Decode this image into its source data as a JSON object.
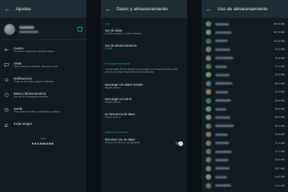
{
  "panel1": {
    "title": "Ajustes",
    "back_icon": "arrow-left-icon",
    "accent": "#00a884",
    "menu": [
      {
        "label": "Cuenta",
        "sub": "Privacidad, seguridad, cambiar número",
        "icon": "key-icon"
      },
      {
        "label": "Chats",
        "sub": "Tema, fondos de pantalla, historial de chat",
        "icon": "chat-icon"
      },
      {
        "label": "Notificaciones",
        "sub": "Tonos de mensajes, grupos y llamadas",
        "icon": "bell-icon"
      },
      {
        "label": "Datos y almacenamiento",
        "sub": "Uso de red, descarga automática",
        "icon": "data-circle-icon"
      },
      {
        "label": "Ayuda",
        "sub": "Preguntas frecuentes, contáctanos, políticas",
        "icon": "help-icon"
      },
      {
        "label": "Invitar amigos",
        "sub": "",
        "icon": "people-icon"
      }
    ],
    "from": "from",
    "brand": "FACEBOOK"
  },
  "panel2": {
    "title": "Datos y almacenamiento",
    "uso_header": "Uso",
    "datos_label": "Uso de datos",
    "datos_sub": "6.6 GB enviados • 2.6 GB recibidos",
    "alm_label": "Uso de almacenamiento",
    "alm_sub": "1.5 GB",
    "descarga_header": "Descarga automática",
    "descarga_desc": "Los mensajes de voz siempre se descargan de forma automática para ofrecer una mejor experiencia de comunicación",
    "movil_label": "Descargar con datos móviles",
    "movil_sub": "Ningún archivo",
    "wifi_label": "Descargar con Wi-Fi",
    "wifi_sub": "Ningún archivo",
    "itinerancia_label": "En itinerancia de datos",
    "itinerancia_sub": "Ningún archivo",
    "llamadas_header": "Ajustes de llamadas",
    "disminuir_label": "Disminuir uso de datos",
    "disminuir_sub": "Reduce los datos de las llamadas",
    "disminuir_on": false
  },
  "panel3": {
    "title": "Uso de almacenamiento",
    "sizes": [
      "384.8 MB",
      "367.5 MB",
      "131.8 MB",
      "79.4 MB",
      "78.4 MB",
      "72.1 MB",
      "67.5 MB",
      "54.2 MB",
      "47.0 MB",
      "35.6 MB",
      "25.5 MB",
      "25.5 MB",
      "20.3 MB",
      "19.8 MB",
      "17.3 MB",
      "17.1 MB",
      "16.6 MB",
      "15.7 MB",
      "14.6 MB",
      "14.1 MB"
    ],
    "avatar_colors": [
      "#5e8a6a",
      "#7c8a6e",
      "#3f6a5a",
      "#6d7f88",
      "#8a7a56",
      "#4d6f5c",
      "#799462",
      "#5a6e7a",
      "#93805f",
      "#4f7358",
      "#6a8c7a",
      "#74886a",
      "#5d7868",
      "#8b6f62",
      "#6a7e5a",
      "#597064",
      "#7a6e56",
      "#667f74",
      "#8a8a6a",
      "#557063"
    ]
  }
}
